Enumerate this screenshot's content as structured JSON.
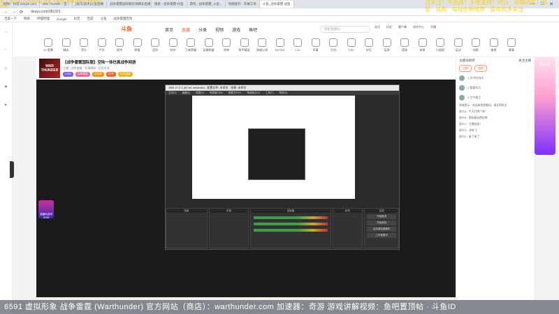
{
  "browser": {
    "tabs": [
      "视频》 抖音 douyin.com",
      "War Thunder - 百...",
      "[技巧/战术]斗鱼直播",
      "战争雷霆国际服在线精彩直播",
      "搜索 - 战争雷霆·抖鱼",
      "游戏 · 战争雷霆_斗鱼...",
      "地图提升 · 军械工坊",
      "斗鱼_战争雷霆 战鱼"
    ],
    "url": "douyu.com/281321",
    "bookmarks": [
      "百度一下",
      "网易",
      "哔哩哔哩",
      "Google",
      "抖音",
      "百度",
      "斗鱼",
      "战争雷霆百科"
    ]
  },
  "overlay": {
    "top_left": "官方 douyin.com/fkxqq 设置 >通用>基本功能>战术指示标记",
    "top_right": "点关注！不迷路！多谢支持！明日 · 投稿动态：战雷 · 战舰 · 海战全新推荐 · 喜欢就多关注"
  },
  "site": {
    "logo": "斗鱼",
    "nav": [
      "首页",
      "直播",
      "分类",
      "视频",
      "游戏",
      "鱼吧"
    ],
    "search_placeholder": "搜索直播间",
    "header_icons": [
      "关注",
      "历史",
      "客户端",
      "创作中心",
      "开播"
    ]
  },
  "categories": [
    "12 直播",
    "精选",
    "音乐",
    "户外",
    "星秀",
    "颜值",
    "竞技",
    "科技",
    "王者荣耀",
    "英雄联盟",
    "原神",
    "和平精英",
    "穿越火线",
    "DOTA2",
    "LOL",
    "军事",
    "主机",
    "CS2",
    "炉石",
    "足球",
    "篮球",
    "体育",
    "小姐姐",
    "运动",
    "电影",
    "美食",
    "赛事"
  ],
  "stream": {
    "avatar_text": "WAR THUNDER",
    "title": "【战争雷霆国际服】空陆一体仿真战争网游",
    "subtitle": "主播 · 战争雷霆 · 军事模拟 · 坦克对战",
    "tags": [
      "LV52",
      "战争雷霆",
      "国际服",
      "坦克",
      "历史游戏"
    ]
  },
  "obs": {
    "title": "OBS 27.2.1 (64 bit, windows) - 配置文件: 未命名 - 场景: 未命名",
    "menu": [
      "文件(F)",
      "编辑(E)",
      "视图(V)",
      "停靠窗口(D)",
      "配置文件(P)",
      "场景集合(S)",
      "工具(T)",
      "帮助(H)"
    ],
    "docks": [
      "场景",
      "来源",
      "混音器",
      "转场",
      "控制"
    ],
    "controls": [
      "开始推流",
      "开始录制",
      "启动虚拟摄像机",
      "工作室模式",
      "设置",
      "退出"
    ],
    "status": "LIVE: 00:00:00  REC: 00:00:00  CPU: 2.3%, 60.00 fps"
  },
  "sidebar": {
    "head_left": "主播贡献榜",
    "head_right": "关注主播",
    "tabs": [
      "日榜",
      "周榜"
    ],
    "ranks": [
      "1 风中的战车",
      "2 雷霆老兵",
      "3 空中霸主"
    ],
    "chats": [
      "系统提示：欢迎来到直播间，请文明发言",
      "观众A：今天打哪个系？",
      "观众B：国际服玩得好爽",
      "观众C：主播加油！",
      "观众D：求带飞",
      "观众E：来了来了"
    ]
  },
  "promo": {
    "card": "鱼乐推荐",
    "game_badge": "直播玩游戏 20/28"
  },
  "ticker": "6591 虚拟形象 战争雷霆 (Warthunder) 官方网站（商店）：warthunder.com 加速器：奇游 游戏讲解视频：鱼吧置顶帖 · 斗鱼ID"
}
